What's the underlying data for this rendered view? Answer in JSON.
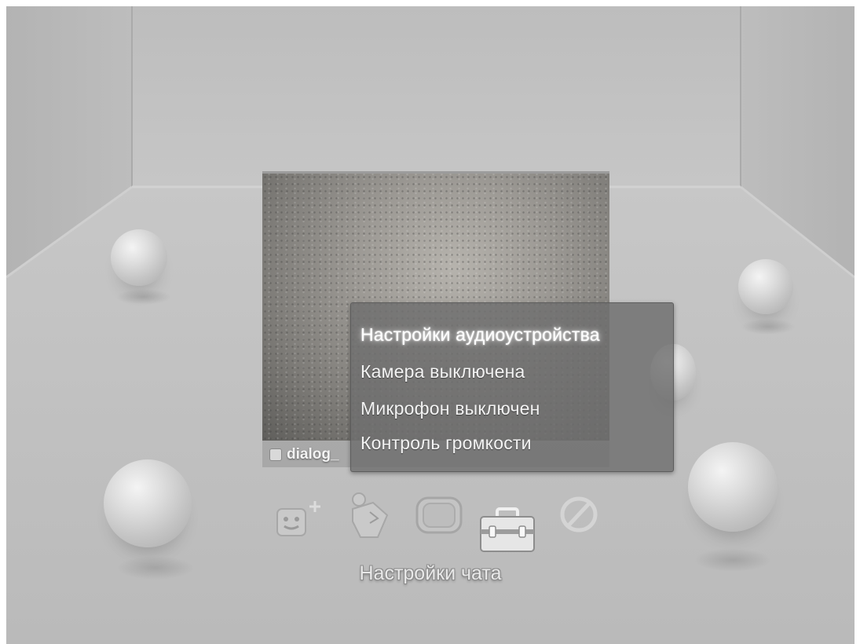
{
  "camera": {
    "user_name": "dialog_"
  },
  "context_menu": {
    "items": [
      {
        "label": "Настройки аудиоустройства",
        "selected": true
      },
      {
        "label": "Камера выключена",
        "selected": false
      },
      {
        "label": "Микрофон выключен",
        "selected": false
      },
      {
        "label": "Контроль громкости",
        "selected": false
      }
    ]
  },
  "icon_bar": {
    "icons": [
      "add-friend-icon",
      "invite-box-icon",
      "screen-icon",
      "toolbox-icon",
      "no-entry-icon"
    ],
    "selected_icon": "toolbox-icon",
    "caption": "Настройки чата"
  },
  "colors": {
    "background": "#b9b9b9",
    "menu_bg": "#6e6e6e",
    "menu_text": "#f3f3f3"
  }
}
